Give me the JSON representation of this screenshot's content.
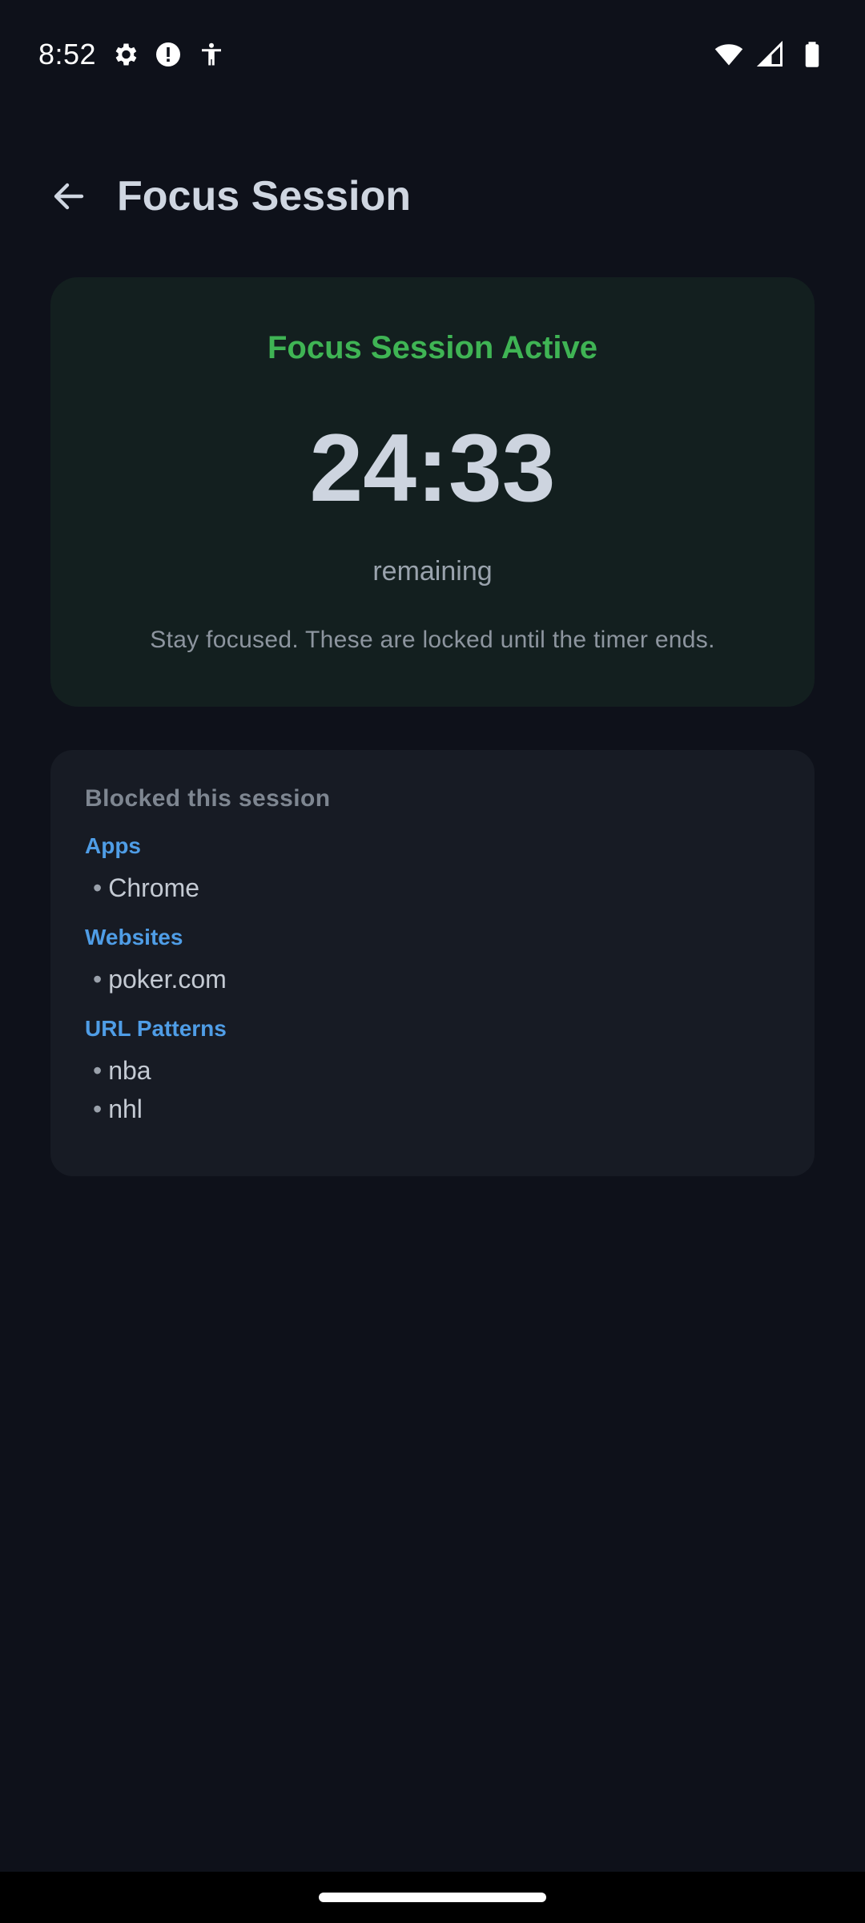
{
  "status_bar": {
    "time": "8:52",
    "icons_left": [
      "gear-icon",
      "alert-icon",
      "accessibility-icon"
    ],
    "icons_right": [
      "wifi-icon",
      "signal-icon",
      "battery-icon"
    ]
  },
  "app_bar": {
    "back_icon": "arrow-left-icon",
    "title": "Focus Session"
  },
  "session": {
    "status": "Focus Session Active",
    "timer": "24:33",
    "remaining_label": "remaining",
    "message": "Stay focused. These are locked until the timer ends."
  },
  "blocked": {
    "heading": "Blocked this session",
    "apps_label": "Apps",
    "apps": [
      "Chrome"
    ],
    "websites_label": "Websites",
    "websites": [
      "poker.com"
    ],
    "patterns_label": "URL Patterns",
    "patterns": [
      "nba",
      "nhl"
    ]
  },
  "colors": {
    "background": "#0e111a",
    "active_card": "#131f1f",
    "accent_green": "#3fb454",
    "accent_blue": "#4f9de6",
    "blocked_card": "#171b24"
  }
}
